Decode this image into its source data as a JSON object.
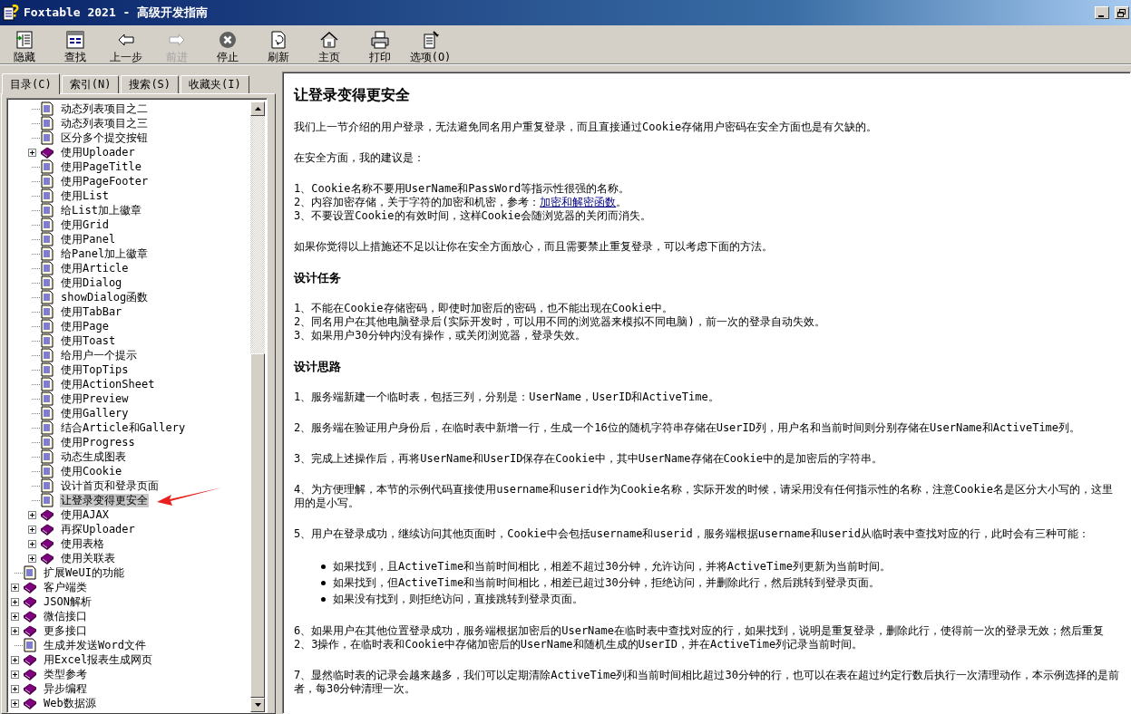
{
  "window": {
    "title": "Foxtable 2021 - 高级开发指南"
  },
  "toolbar": [
    {
      "label": "隐藏",
      "disabled": false
    },
    {
      "label": "查找",
      "disabled": false
    },
    {
      "label": "上一步",
      "disabled": false
    },
    {
      "label": "前进",
      "disabled": true
    },
    {
      "label": "停止",
      "disabled": false
    },
    {
      "label": "刷新",
      "disabled": false
    },
    {
      "label": "主页",
      "disabled": false
    },
    {
      "label": "打印",
      "disabled": false
    },
    {
      "label": "选项(O)",
      "disabled": false
    }
  ],
  "tabs": [
    {
      "label": "目录(C)",
      "selected": true
    },
    {
      "label": "索引(N)",
      "selected": false
    },
    {
      "label": "搜索(S)",
      "selected": false
    },
    {
      "label": "收藏夹(I)",
      "selected": false
    }
  ],
  "tree": {
    "items": [
      {
        "children": [
          {
            "label": "动态列表项目之二",
            "kind": "page",
            "selected": false
          },
          {
            "label": "动态列表项目之三",
            "kind": "page",
            "selected": false
          },
          {
            "label": "区分多个提交按钮",
            "kind": "page",
            "selected": false
          },
          {
            "label": "使用Uploader",
            "kind": "book",
            "expanded": false,
            "selected": false
          },
          {
            "label": "使用PageTitle",
            "kind": "page",
            "selected": false
          },
          {
            "label": "使用PageFooter",
            "kind": "page",
            "selected": false
          },
          {
            "label": "使用List",
            "kind": "page",
            "selected": false
          },
          {
            "label": "给List加上徽章",
            "kind": "page",
            "selected": false
          },
          {
            "label": "使用Grid",
            "kind": "page",
            "selected": false
          },
          {
            "label": "使用Panel",
            "kind": "page",
            "selected": false
          },
          {
            "label": "给Panel加上徽章",
            "kind": "page",
            "selected": false
          },
          {
            "label": "使用Article",
            "kind": "page",
            "selected": false
          },
          {
            "label": "使用Dialog",
            "kind": "page",
            "selected": false
          },
          {
            "label": "showDialog函数",
            "kind": "page",
            "selected": false
          },
          {
            "label": "使用TabBar",
            "kind": "page",
            "selected": false
          },
          {
            "label": "使用Page",
            "kind": "page",
            "selected": false
          },
          {
            "label": "使用Toast",
            "kind": "page",
            "selected": false
          },
          {
            "label": "给用户一个提示",
            "kind": "page",
            "selected": false
          },
          {
            "label": "使用TopTips",
            "kind": "page",
            "selected": false
          },
          {
            "label": "使用ActionSheet",
            "kind": "page",
            "selected": false
          },
          {
            "label": "使用Preview",
            "kind": "page",
            "selected": false
          },
          {
            "label": "使用Gallery",
            "kind": "page",
            "selected": false
          },
          {
            "label": "结合Article和Gallery",
            "kind": "page",
            "selected": false
          },
          {
            "label": "使用Progress",
            "kind": "page",
            "selected": false
          },
          {
            "label": "动态生成图表",
            "kind": "page",
            "selected": false
          },
          {
            "label": "使用Cookie",
            "kind": "page",
            "selected": false
          },
          {
            "label": "设计首页和登录页面",
            "kind": "page",
            "selected": false
          },
          {
            "label": "让登录变得更安全",
            "kind": "page",
            "selected": true
          },
          {
            "label": "使用AJAX",
            "kind": "book",
            "expanded": false,
            "selected": false
          },
          {
            "label": "再探Uploader",
            "kind": "book",
            "expanded": false,
            "selected": false
          },
          {
            "label": "使用表格",
            "kind": "book",
            "expanded": false,
            "selected": false
          },
          {
            "label": "使用关联表",
            "kind": "book",
            "expanded": false,
            "selected": false
          }
        ]
      },
      {
        "label": "扩展WeUI的功能",
        "kind": "page",
        "selected": false
      },
      {
        "label": "客户端类",
        "kind": "book",
        "expanded": false,
        "selected": false
      },
      {
        "label": "JSON解析",
        "kind": "book",
        "expanded": false,
        "selected": false
      },
      {
        "label": "微信接口",
        "kind": "book",
        "expanded": false,
        "selected": false
      },
      {
        "label": "更多接口",
        "kind": "book",
        "expanded": false,
        "selected": false
      },
      {
        "label": "生成并发送Word文件",
        "kind": "page",
        "selected": false
      },
      {
        "label": "用Excel报表生成网页",
        "kind": "book",
        "expanded": false,
        "selected": false
      },
      {
        "label": "类型参考",
        "kind": "book",
        "expanded": false,
        "selected": false
      },
      {
        "label": "异步编程",
        "kind": "book",
        "expanded": false,
        "selected": false
      },
      {
        "label": "Web数据源",
        "kind": "book",
        "expanded": false,
        "selected": false
      }
    ]
  },
  "article": {
    "title": "让登录变得更安全",
    "blocks": [
      {
        "kind": "paragraph",
        "text": "我们上一节介绍的用户登录，无法避免同名用户重复登录，而且直接通过Cookie存储用户密码在安全方面也是有欠缺的。"
      },
      {
        "kind": "paragraph",
        "text": "在安全方面，我的建议是："
      },
      {
        "kind": "lines",
        "lines": [
          {
            "text": "1、Cookie名称不要用UserName和PassWord等指示性很强的名称。"
          },
          {
            "text": "2、内容加密存储，关于字符的加密和机密，参考：",
            "link": "加密和解密函数",
            "tail": "。"
          },
          {
            "text": "3、不要设置Cookie的有效时间，这样Cookie会随浏览器的关闭而消失。"
          }
        ]
      },
      {
        "kind": "paragraph",
        "text": "如果你觉得以上措施还不足以让你在安全方面放心，而且需要禁止重复登录，可以考虑下面的方法。"
      },
      {
        "kind": "heading",
        "text": "设计任务"
      },
      {
        "kind": "lines",
        "lines": [
          {
            "text": "1、不能在Cookie存储密码，即使时加密后的密码，也不能出现在Cookie中。"
          },
          {
            "text": "2、同名用户在其他电脑登录后(实际开发时，可以用不同的浏览器来模拟不同电脑)，前一次的登录自动失效。"
          },
          {
            "text": "3、如果用户30分钟内没有操作，或关闭浏览器，登录失效。"
          }
        ]
      },
      {
        "kind": "heading",
        "text": "设计思路"
      },
      {
        "kind": "paragraph",
        "text": "1、服务端新建一个临时表，包括三列，分别是：UserName，UserID和ActiveTime。"
      },
      {
        "kind": "paragraph",
        "text": "2、服务端在验证用户身份后，在临时表中新增一行，生成一个16位的随机字符串存储在UserID列，用户名和当前时间则分别存储在UserName和ActiveTime列。"
      },
      {
        "kind": "paragraph",
        "text": "3、完成上述操作后，再将UserName和UserID保存在Cookie中，其中UserName存储在Cookie中的是加密后的字符串。"
      },
      {
        "kind": "paragraph",
        "text": "4、为方便理解，本节的示例代码直接使用username和userid作为Cookie名称，实际开发的时候，请采用没有任何指示性的名称，注意Cookie名是区分大小写的，这里用的是小写。"
      },
      {
        "kind": "paragraph",
        "text": "5、用户在登录成功，继续访问其他页面时，Cookie中会包括username和userid，服务端根据username和userid从临时表中查找对应的行，此时会有三种可能："
      },
      {
        "kind": "bullets",
        "items": [
          "如果找到，且ActiveTime和当前时间相比，相差不超过30分钟，允许访问，并将ActiveTime列更新为当前时间。",
          "如果找到，但ActiveTime和当前时间相比，相差已超过30分钟，拒绝访问，并删除此行，然后跳转到登录页面。",
          "如果没有找到，则拒绝访问，直接跳转到登录页面。"
        ]
      },
      {
        "kind": "paragraph",
        "text": "6、如果用户在其他位置登录成功，服务端根据加密后的UserName在临时表中查找对应的行，如果找到，说明是重复登录，删除此行，使得前一次的登录无效；然后重复2、3操作，在临时表和Cookie中存储加密后的UserName和随机生成的UserID，并在ActiveTime列记录当前时间。"
      },
      {
        "kind": "paragraph",
        "text": "7、显然临时表的记录会越来越多，我们可以定期清除ActiveTime列和当前时间相比超过30分钟的行，也可以在表在超过约定行数后执行一次清理动作，本示例选择的是前者，每30分钟清理一次。"
      }
    ]
  }
}
